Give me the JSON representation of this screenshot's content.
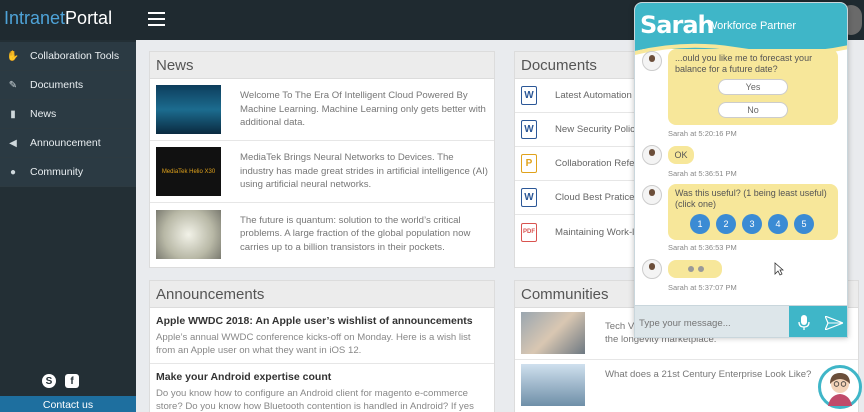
{
  "brand": {
    "part1": "Intranet",
    "part2": "Portal"
  },
  "sidebar": {
    "items": [
      {
        "label": "Collaboration Tools",
        "icon": "handshake-icon"
      },
      {
        "label": "Documents",
        "icon": "edit-icon"
      },
      {
        "label": "News",
        "icon": "file-icon"
      },
      {
        "label": "Announcement",
        "icon": "megaphone-icon"
      },
      {
        "label": "Community",
        "icon": "users-icon"
      }
    ],
    "social": [
      "S",
      "f"
    ],
    "contact": "Contact us"
  },
  "news": {
    "title": "News",
    "items": [
      {
        "text": "Welcome To The Era Of Intelligent Cloud Powered By Machine Learning. Machine Learning only gets better with additional data."
      },
      {
        "text": "MediaTek Brings Neural Networks to Devices. The industry has made great strides in artificial intelligence (AI) using artificial neural networks.",
        "thumb_label": "MediaTek Helio X30"
      },
      {
        "text": "The future is quantum: solution to the world’s critical problems. A large fraction of the global population now carries up to a billion transistors in their pockets."
      }
    ]
  },
  "documents": {
    "title": "Documents",
    "items": [
      {
        "label": "Latest Automation",
        "type": "W"
      },
      {
        "label": "New Security Policy",
        "type": "W"
      },
      {
        "label": "Collaboration Refe",
        "type": "P"
      },
      {
        "label": "Cloud Best Pratices",
        "type": "W"
      },
      {
        "label": "Maintaining Work-l",
        "type": "PDF"
      }
    ]
  },
  "announcements": {
    "title": "Announcements",
    "items": [
      {
        "title": "Apple WWDC 2018: An Apple user’s wishlist of announcements",
        "body": "Apple’s annual WWDC conference kicks-off on Monday. Here is a wish list from an Apple user on what they want in iOS 12."
      },
      {
        "title": "Make your Android expertise count",
        "body": "Do you know how to configure an Android client for magento e-commerce store? Do you know how Bluetooth contention is handled in Android? If yes"
      }
    ]
  },
  "communities": {
    "title": "Communities",
    "items": [
      {
        "text": "Tech V... Entrepreneurs are increasingly attracted to the longevity marketplace."
      },
      {
        "text": "What does a 21st Century Enterprise Look Like?"
      }
    ]
  },
  "chat": {
    "name": "Sarah",
    "role": "Workforce Partner",
    "q1": "...ould you like me to forecast your balance for a future date?",
    "yes": "Yes",
    "no": "No",
    "ts1": "Sarah at 5:20:16 PM",
    "ok": "OK",
    "ts2": "Sarah at 5:36:51 PM",
    "q2": "Was this useful? (1 being least useful) (click one)",
    "ratings": [
      "1",
      "2",
      "3",
      "4",
      "5"
    ],
    "ts3": "Sarah at 5:36:53 PM",
    "ts4": "Sarah at 5:37:07 PM",
    "placeholder": "Type your message..."
  }
}
